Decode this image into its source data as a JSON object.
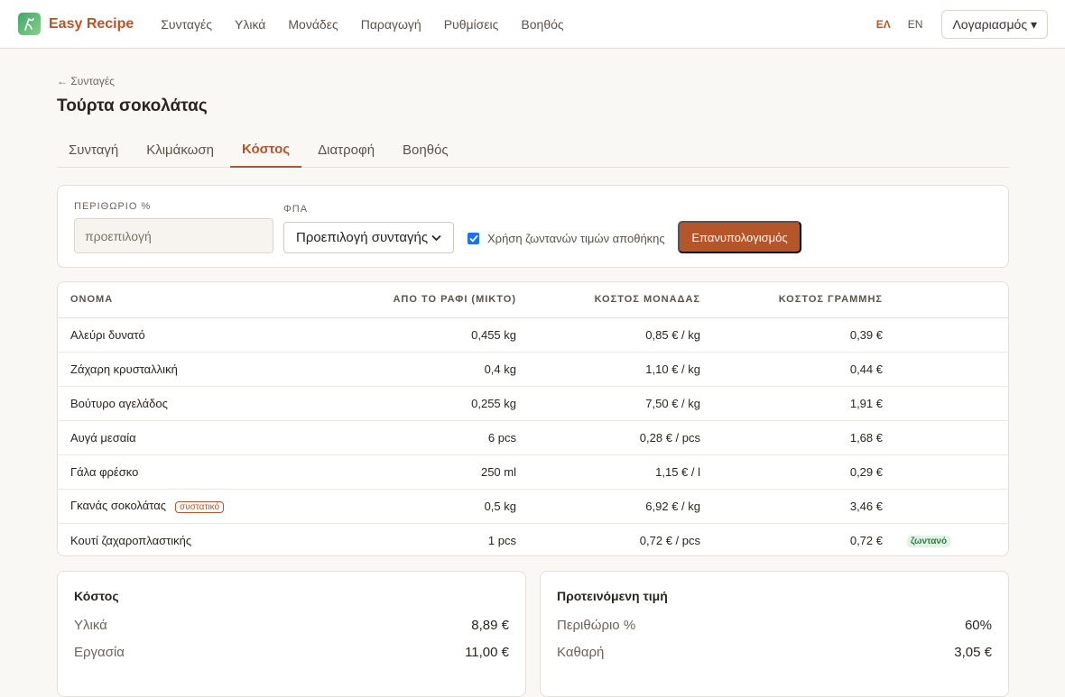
{
  "app": {
    "name": "Easy Recipe"
  },
  "nav": [
    "Συνταγές",
    "Υλικά",
    "Μονάδες",
    "Παραγωγή",
    "Ρυθμίσεις",
    "Βοηθός"
  ],
  "lang": {
    "el": "ΕΛ",
    "en": "EN",
    "active": "el"
  },
  "account_label": "Λογαριασμός ▾",
  "breadcrumb": "← Συνταγές",
  "page_title": "Τούρτα σοκολάτας",
  "tabs": [
    {
      "label": "Συνταγή"
    },
    {
      "label": "Κλιμάκωση"
    },
    {
      "label": "Κόστος",
      "active": true
    },
    {
      "label": "Διατροφή"
    },
    {
      "label": "Βοηθός"
    }
  ],
  "controls": {
    "margin_label": "ΠΕΡΙΘΩΡΙΟ %",
    "margin_placeholder": "προεπιλογή",
    "vat_label": "ΦΠΑ",
    "vat_value": "Προεπιλογή συνταγής",
    "live_prices_label": "Χρήση ζωντανών τιμών αποθήκης",
    "live_prices_checked": true,
    "recalc_label": "Επανυπολογισμός"
  },
  "table": {
    "headers": [
      "ΟΝΟΜΑ",
      "ΑΠΟ ΤΟ ΡΑΦΙ (ΜΙΚΤΟ)",
      "ΚΟΣΤΟΣ ΜΟΝΑΔΑΣ",
      "ΚΟΣΤΟΣ ΓΡΑΜΜΗΣ"
    ],
    "rows": [
      {
        "name": "Αλεύρι δυνατό",
        "shelf": "0,455 kg",
        "unit_cost": "0,85 € / kg",
        "line_cost": "0,39 €",
        "tag": "",
        "status": ""
      },
      {
        "name": "Ζάχαρη κρυσταλλική",
        "shelf": "0,4 kg",
        "unit_cost": "1,10 € / kg",
        "line_cost": "0,44 €",
        "tag": "",
        "status": ""
      },
      {
        "name": "Βούτυρο αγελάδος",
        "shelf": "0,255 kg",
        "unit_cost": "7,50 € / kg",
        "line_cost": "1,91 €",
        "tag": "",
        "status": ""
      },
      {
        "name": "Αυγά μεσαία",
        "shelf": "6 pcs",
        "unit_cost": "0,28 € / pcs",
        "line_cost": "1,68 €",
        "tag": "",
        "status": ""
      },
      {
        "name": "Γάλα φρέσκο",
        "shelf": "250 ml",
        "unit_cost": "1,15 € / l",
        "line_cost": "0,29 €",
        "tag": "",
        "status": ""
      },
      {
        "name": "Γκανάς σοκολάτας",
        "shelf": "0,5 kg",
        "unit_cost": "6,92 € / kg",
        "line_cost": "3,46 €",
        "tag": "συστατικό",
        "status": ""
      },
      {
        "name": "Κουτί ζαχαροπλαστικής",
        "shelf": "1 pcs",
        "unit_cost": "0,72 € / pcs",
        "line_cost": "0,72 €",
        "tag": "",
        "status": "ζωντανό"
      }
    ]
  },
  "cost_summary": {
    "title": "Κόστος",
    "rows": [
      {
        "label": "Υλικά",
        "value": "8,89 €"
      },
      {
        "label": "Εργασία",
        "value": "11,00 €"
      }
    ]
  },
  "price_summary": {
    "title": "Προτεινόμενη τιμή",
    "rows": [
      {
        "label": "Περιθώριο %",
        "value": "60%"
      },
      {
        "label": "Καθαρή",
        "value": "3,05 €"
      }
    ]
  },
  "colors": {
    "accent": "#b4552a",
    "live_badge_bg": "#e2f3e5",
    "live_badge_fg": "#2f7a45"
  }
}
